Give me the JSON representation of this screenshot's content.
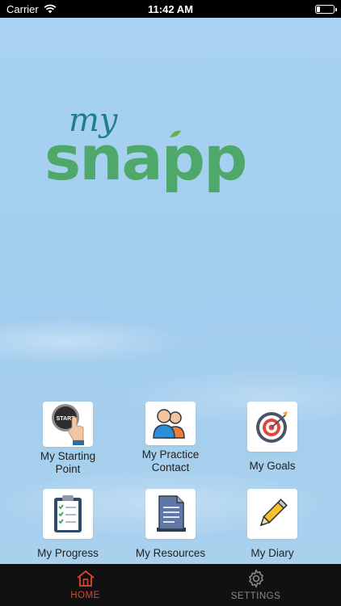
{
  "status_bar": {
    "carrier": "Carrier",
    "time": "11:42 AM"
  },
  "logo": {
    "script_text": "my",
    "word_text": "snapp"
  },
  "tiles": [
    {
      "label": "My Starting\nPoint",
      "icon": "start-button-icon",
      "badge_text": "START"
    },
    {
      "label": "My Practice\nContact",
      "icon": "people-icon"
    },
    {
      "label": "My Goals",
      "icon": "target-icon"
    },
    {
      "label": "My Progress",
      "icon": "clipboard-checklist-icon"
    },
    {
      "label": "My Resources",
      "icon": "document-icon"
    },
    {
      "label": "My Diary",
      "icon": "pencil-icon"
    }
  ],
  "tab_bar": {
    "tabs": [
      {
        "label": "HOME",
        "icon": "home-icon",
        "active": true
      },
      {
        "label": "SETTINGS",
        "icon": "gear-icon",
        "active": false
      }
    ]
  },
  "colors": {
    "active_tab": "#e0442c",
    "inactive_tab": "#8a8a8a",
    "logo_teal": "#1a9aa0",
    "logo_green": "#6aae4e",
    "logo_script": "#1f7f88"
  }
}
